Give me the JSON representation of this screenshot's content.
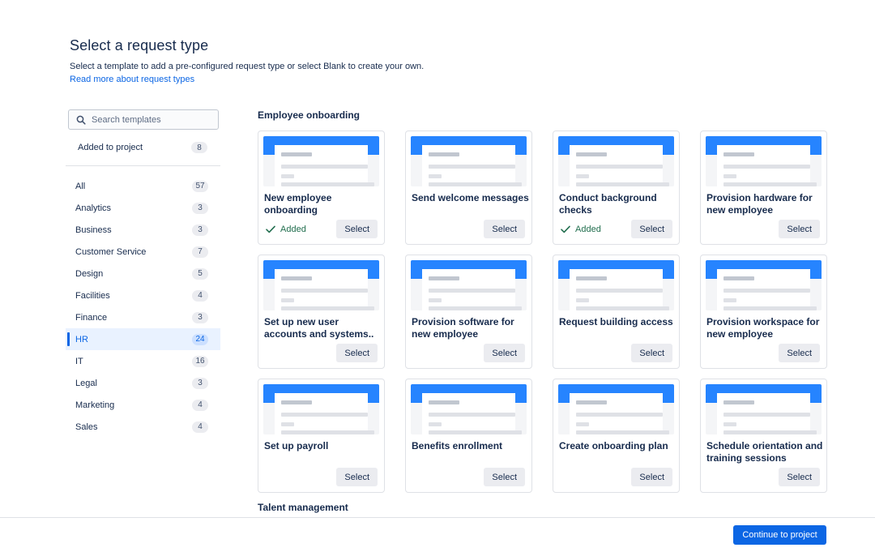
{
  "header": {
    "title": "Select a request type",
    "subtitle": "Select a template to add a pre-configured request type or select Blank to create your own.",
    "link": "Read more about request types"
  },
  "sidebar": {
    "search_placeholder": "Search templates",
    "added": {
      "label": "Added to project",
      "count": "8"
    },
    "categories": [
      {
        "label": "All",
        "count": "57"
      },
      {
        "label": "Analytics",
        "count": "3"
      },
      {
        "label": "Business",
        "count": "3"
      },
      {
        "label": "Customer Service",
        "count": "7"
      },
      {
        "label": "Design",
        "count": "5"
      },
      {
        "label": "Facilities",
        "count": "4"
      },
      {
        "label": "Finance",
        "count": "3"
      },
      {
        "label": "HR",
        "count": "24",
        "active": true
      },
      {
        "label": "IT",
        "count": "16"
      },
      {
        "label": "Legal",
        "count": "3"
      },
      {
        "label": "Marketing",
        "count": "4"
      },
      {
        "label": "Sales",
        "count": "4"
      }
    ]
  },
  "main": {
    "sections": [
      {
        "title": "Employee onboarding"
      },
      {
        "title": "Talent management"
      }
    ],
    "select_label": "Select",
    "added_label": "Added",
    "templates": [
      {
        "title": "New employee onboarding",
        "added": true
      },
      {
        "title": "Send welcome messages",
        "added": false
      },
      {
        "title": "Conduct background checks",
        "added": true
      },
      {
        "title": "Provision hardware for new employee",
        "added": false
      },
      {
        "title": "Set up new user accounts and systems..",
        "added": false
      },
      {
        "title": "Provision software for new employee",
        "added": false
      },
      {
        "title": "Request building access",
        "added": false
      },
      {
        "title": "Provision workspace for new employee",
        "added": false
      },
      {
        "title": "Set up payroll",
        "added": false
      },
      {
        "title": "Benefits enrollment",
        "added": false
      },
      {
        "title": "Create onboarding plan",
        "added": false
      },
      {
        "title": "Schedule orientation and training sessions",
        "added": false
      }
    ]
  },
  "footer": {
    "continue_label": "Continue to project"
  },
  "colors": {
    "accent": "#0c66e4",
    "thumb_band": "#2684ff",
    "added_green": "#216e4e"
  },
  "icons": {
    "search": "search-icon",
    "check": "check-icon"
  }
}
